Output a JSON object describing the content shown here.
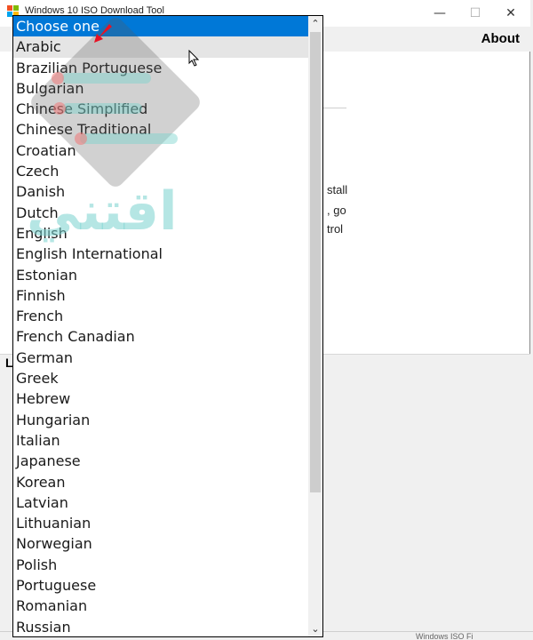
{
  "window": {
    "title": "Windows 10 ISO Download Tool",
    "minimize_glyph": "—",
    "maximize_glyph": "☐",
    "close_glyph": "✕",
    "menu_about": "About",
    "body_lines": [
      "stall",
      ", go",
      "trol"
    ],
    "status_label": "L",
    "bottom_status": "Windows ISO Fi"
  },
  "dropdown": {
    "selected_label": "Choose one",
    "hovered_index": 1,
    "options": [
      "Choose one",
      "Arabic",
      "Brazilian Portuguese",
      "Bulgarian",
      "Chinese Simplified",
      "Chinese Traditional",
      "Croatian",
      "Czech",
      "Danish",
      "Dutch",
      "English",
      "English International",
      "Estonian",
      "Finnish",
      "French",
      "French Canadian",
      "German",
      "Greek",
      "Hebrew",
      "Hungarian",
      "Italian",
      "Japanese",
      "Korean",
      "Latvian",
      "Lithuanian",
      "Norwegian",
      "Polish",
      "Portuguese",
      "Romanian",
      "Russian"
    ],
    "scroll_up_glyph": "⌃",
    "scroll_down_glyph": "⌄",
    "scroll_position": 0.0
  },
  "watermark": {
    "text": "اقتني"
  },
  "colors": {
    "selection": "#0078d7",
    "hover": "#e5e5e5",
    "arrow": "#e81123"
  }
}
